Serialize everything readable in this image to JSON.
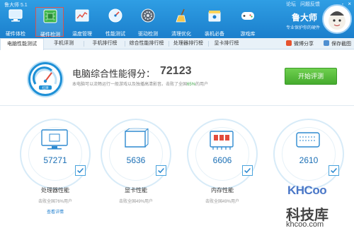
{
  "app": {
    "title": "鲁大师 5.1",
    "links": [
      "论坛",
      "问题反馈"
    ],
    "controls": [
      "-",
      "×"
    ]
  },
  "toolbar": {
    "items": [
      {
        "label": "硬件体检",
        "icon": "monitor-icon"
      },
      {
        "label": "硬件检测",
        "icon": "circuit-board-icon"
      },
      {
        "label": "温度管理",
        "icon": "thermometer-chart-icon"
      },
      {
        "label": "性能测试",
        "icon": "speedometer-icon"
      },
      {
        "label": "驱动检测",
        "icon": "driver-gear-icon"
      },
      {
        "label": "清理优化",
        "icon": "broom-icon"
      },
      {
        "label": "装机必备",
        "icon": "package-box-icon"
      },
      {
        "label": "游戏库",
        "icon": "gamepad-icon"
      }
    ],
    "active_index": 1
  },
  "user": {
    "name": "鲁大师",
    "subtitle": "专业保护你的硬件"
  },
  "tabs": {
    "items": [
      "电脑性能测试",
      "手机评测",
      "手机排行榜",
      "综合性能排行榜",
      "处理器排行榜",
      "显卡排行榜"
    ],
    "active_index": 0,
    "share": "微博分享",
    "save": "保存截图"
  },
  "score": {
    "label": "电脑综合性能得分：",
    "value": "72123",
    "desc_before": "本电脑可以流畅运行一般游戏以及独播高清影音。击败了全国",
    "desc_percent": "65%",
    "desc_after": "的用户",
    "gauge_badge": "红牌",
    "start_button": "开始评测"
  },
  "components": [
    {
      "value": "57271",
      "name": "处理器性能",
      "pct": "击败全国76%用户",
      "link": "查看详情",
      "icon": "cpu-monitor-icon"
    },
    {
      "value": "5636",
      "name": "显卡性能",
      "pct": "击败全国49%用户",
      "link": "",
      "icon": "graphics-card-icon"
    },
    {
      "value": "6606",
      "name": "内存性能",
      "pct": "击败全国49%用户",
      "link": "",
      "icon": "memory-chip-icon"
    },
    {
      "value": "2610",
      "name": "",
      "pct": "",
      "link": "",
      "icon": "hard-disk-icon"
    }
  ],
  "watermark": {
    "logo": "KHCoo",
    "cn": "科技库",
    "url": "khcoo.com"
  },
  "colors": {
    "toolbar": "#1b7fcc",
    "accent": "#1e90d6",
    "start_button": "#45ab2e",
    "percent": "#3da447"
  }
}
